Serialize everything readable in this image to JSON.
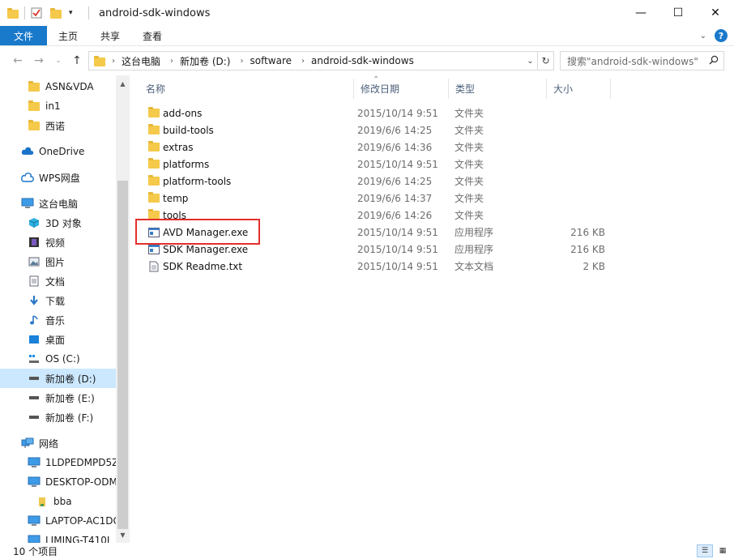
{
  "window": {
    "title": "android-sdk-windows",
    "minimize": "—",
    "maximize": "☐",
    "close": "✕"
  },
  "ribbon": {
    "file_tab": "文件",
    "tabs": [
      "主页",
      "共享",
      "查看"
    ],
    "expand_icon": "chevron-down-icon",
    "help_label": "?"
  },
  "address": {
    "crumbs": [
      "这台电脑",
      "新加卷 (D:)",
      "software",
      "android-sdk-windows"
    ],
    "search_placeholder": "搜索\"android-sdk-windows\""
  },
  "nav": {
    "items": [
      {
        "label": "ASN&VDA",
        "icon": "folder-icon"
      },
      {
        "label": "in1",
        "icon": "folder-icon"
      },
      {
        "label": "西诺",
        "icon": "folder-icon"
      },
      {
        "label": "OneDrive",
        "icon": "cloud-icon"
      },
      {
        "label": "WPS网盘",
        "icon": "wps-cloud-icon"
      },
      {
        "label": "这台电脑",
        "icon": "computer-icon"
      },
      {
        "label": "3D 对象",
        "icon": "3d-objects-icon"
      },
      {
        "label": "视频",
        "icon": "video-icon"
      },
      {
        "label": "图片",
        "icon": "pictures-icon"
      },
      {
        "label": "文档",
        "icon": "documents-icon"
      },
      {
        "label": "下载",
        "icon": "download-icon"
      },
      {
        "label": "音乐",
        "icon": "music-icon"
      },
      {
        "label": "桌面",
        "icon": "desktop-icon"
      },
      {
        "label": "OS (C:)",
        "icon": "os-drive-icon"
      },
      {
        "label": "新加卷 (D:)",
        "icon": "drive-icon"
      },
      {
        "label": "新加卷 (E:)",
        "icon": "drive-icon"
      },
      {
        "label": "新加卷 (F:)",
        "icon": "drive-icon"
      },
      {
        "label": "网络",
        "icon": "network-icon"
      },
      {
        "label": "1LDPEDMPD5Z",
        "icon": "network-computer-icon"
      },
      {
        "label": "DESKTOP-ODM",
        "icon": "network-computer-icon"
      },
      {
        "label": "bba",
        "icon": "user-folder-icon"
      },
      {
        "label": "LAPTOP-AC1DC",
        "icon": "network-computer-icon"
      },
      {
        "label": "LIMING-T410L",
        "icon": "network-computer-icon"
      }
    ],
    "selected": "新加卷 (D:)"
  },
  "columns": {
    "name": "名称",
    "date": "修改日期",
    "type": "类型",
    "size": "大小"
  },
  "files": [
    {
      "name": "add-ons",
      "date": "2015/10/14 9:51",
      "type": "文件夹",
      "size": "",
      "icon": "folder-icon"
    },
    {
      "name": "build-tools",
      "date": "2019/6/6 14:25",
      "type": "文件夹",
      "size": "",
      "icon": "folder-icon"
    },
    {
      "name": "extras",
      "date": "2019/6/6 14:36",
      "type": "文件夹",
      "size": "",
      "icon": "folder-icon"
    },
    {
      "name": "platforms",
      "date": "2015/10/14 9:51",
      "type": "文件夹",
      "size": "",
      "icon": "folder-icon"
    },
    {
      "name": "platform-tools",
      "date": "2019/6/6 14:25",
      "type": "文件夹",
      "size": "",
      "icon": "folder-icon"
    },
    {
      "name": "temp",
      "date": "2019/6/6 14:37",
      "type": "文件夹",
      "size": "",
      "icon": "folder-icon"
    },
    {
      "name": "tools",
      "date": "2019/6/6 14:26",
      "type": "文件夹",
      "size": "",
      "icon": "folder-icon"
    },
    {
      "name": "AVD Manager.exe",
      "date": "2015/10/14 9:51",
      "type": "应用程序",
      "size": "216 KB",
      "icon": "application-icon"
    },
    {
      "name": "SDK Manager.exe",
      "date": "2015/10/14 9:51",
      "type": "应用程序",
      "size": "216 KB",
      "icon": "application-icon"
    },
    {
      "name": "SDK Readme.txt",
      "date": "2015/10/14 9:51",
      "type": "文本文档",
      "size": "2 KB",
      "icon": "text-file-icon"
    }
  ],
  "status": {
    "count": "10 个项目"
  },
  "colors": {
    "accent": "#1979ca",
    "selected_bg": "#cce8ff",
    "highlight_border": "#e2302c",
    "folder": "#f5c94a"
  }
}
